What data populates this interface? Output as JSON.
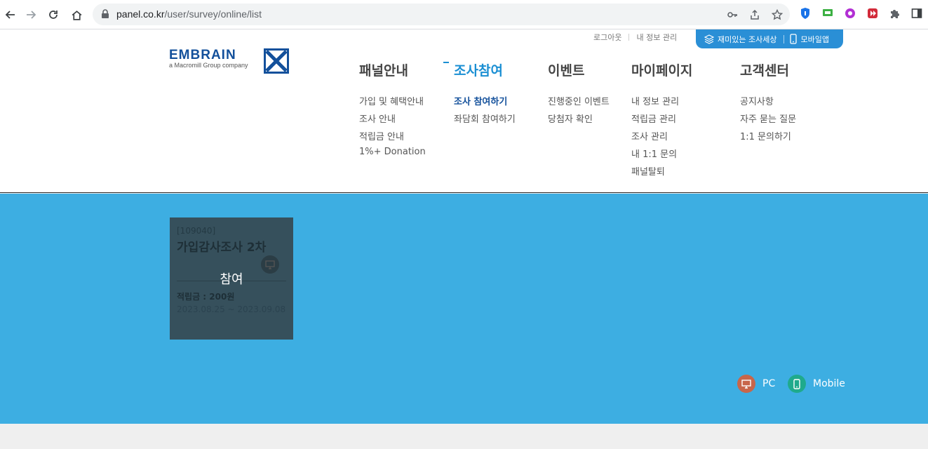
{
  "browser": {
    "url_host": "panel.co.kr",
    "url_path": "/user/survey/online/list"
  },
  "header": {
    "util": {
      "logout": "로그아웃",
      "my_info": "내 정보 관리",
      "fun_survey": "재미있는 조사세상",
      "mobile_app": "모바일앱"
    },
    "logo": {
      "word": "EMBRAIN",
      "sub": "a Macromill Group company"
    },
    "menu": [
      {
        "title": "패널안내",
        "items": [
          "가입 및 혜택안내",
          "조사 안내",
          "적립금 안내",
          "1%+ Donation"
        ]
      },
      {
        "title": "조사참여",
        "items": [
          "조사 참여하기",
          "좌담회 참여하기"
        ]
      },
      {
        "title": "이벤트",
        "items": [
          "진행중인 이벤트",
          "당첨자 확인"
        ]
      },
      {
        "title": "마이페이지",
        "items": [
          "내 정보 관리",
          "적립금 관리",
          "조사 관리",
          "내 1:1 문의",
          "패널탈퇴"
        ]
      },
      {
        "title": "고객센터",
        "items": [
          "공지사항",
          "자주 묻는 질문",
          "1:1 문의하기"
        ]
      }
    ]
  },
  "survey_card": {
    "id": "[109040]",
    "title": "가입감사조사 2차",
    "join_label": "참여",
    "reward": "적립금 : 200원",
    "period": "2023.08.25 ~ 2023.09.08"
  },
  "legend": {
    "pc": "PC",
    "mobile": "Mobile"
  },
  "colors": {
    "brand_blue": "#13509b",
    "accent_blue": "#2a8fd6",
    "content_bg": "#3daee2",
    "pc_icon": "#c8664a",
    "mobile_icon": "#1faa8c"
  }
}
